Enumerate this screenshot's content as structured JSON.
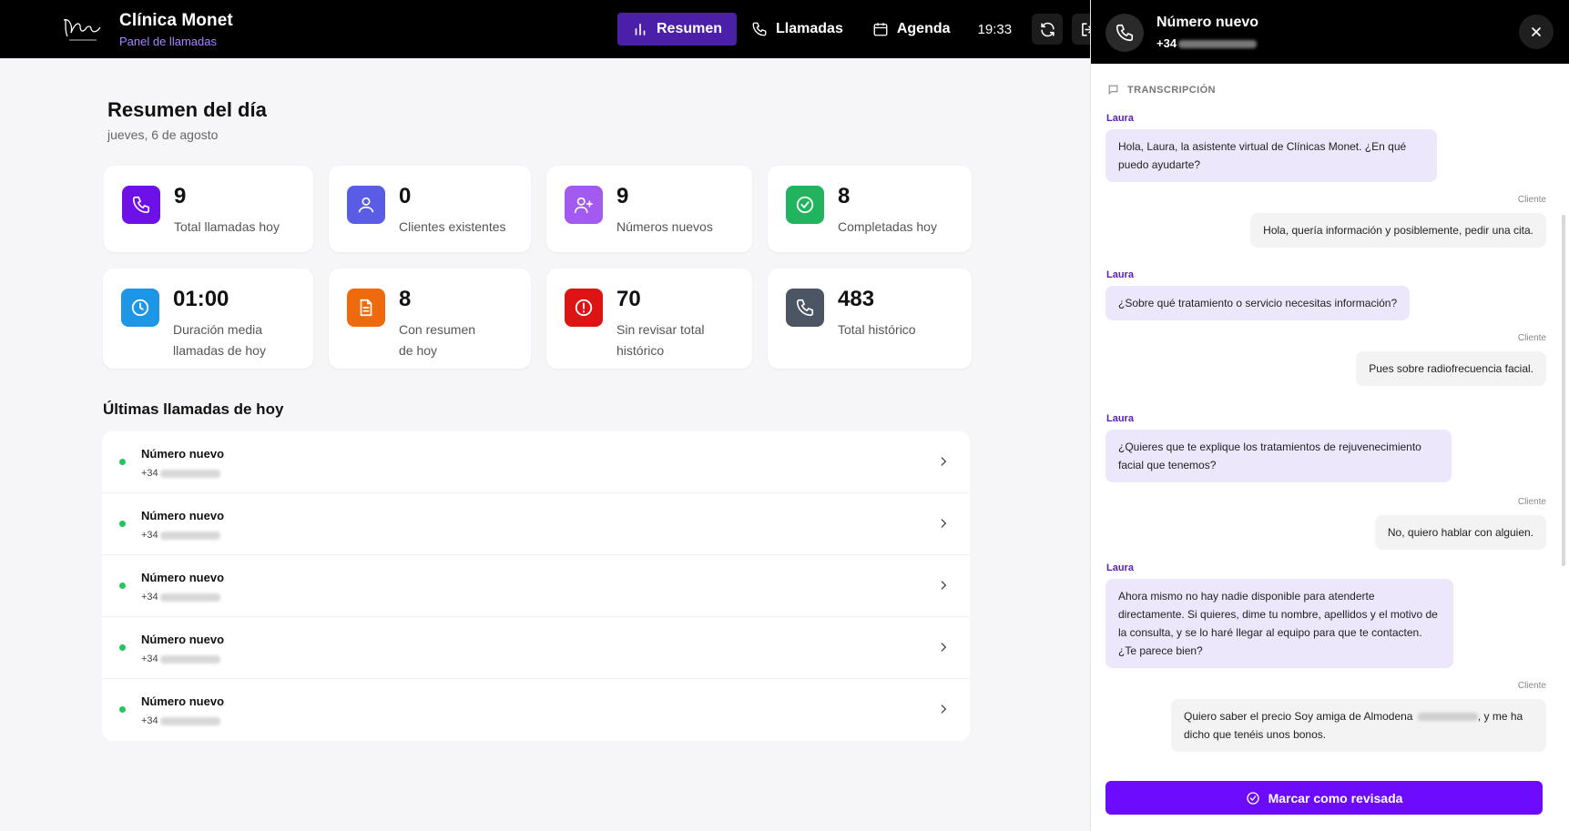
{
  "header": {
    "brand_title": "Clínica Monet",
    "brand_subtitle": "Panel de llamadas",
    "nav": [
      {
        "label": "Resumen",
        "active": true
      },
      {
        "label": "Llamadas",
        "active": false
      },
      {
        "label": "Agenda",
        "active": false
      }
    ],
    "time": "19:33"
  },
  "summary": {
    "title": "Resumen del día",
    "date": "jueves, 6 de agosto"
  },
  "stats": [
    {
      "value": "9",
      "label": "Total llamadas hoy",
      "color": "#6d11e8",
      "icon": "phone-icon"
    },
    {
      "value": "0",
      "label": "Clientes existentes",
      "color": "#5b5ce6",
      "icon": "user-icon"
    },
    {
      "value": "9",
      "label": "Números nuevos",
      "color": "#a35af0",
      "icon": "user-plus-icon"
    },
    {
      "value": "8",
      "label": "Completadas hoy",
      "color": "#22b35e",
      "icon": "check-circle-icon"
    },
    {
      "value": "01:00",
      "label": "Duración media llamadas de hoy",
      "color": "#1e96e6",
      "icon": "clock-icon"
    },
    {
      "value": "8",
      "label": "Con resumen de hoy",
      "color": "#ef6a0c",
      "icon": "document-icon"
    },
    {
      "value": "70",
      "label": "Sin revisar total histórico",
      "color": "#dc1414",
      "icon": "alert-circle-icon"
    },
    {
      "value": "483",
      "label": "Total histórico",
      "color": "#4b5563",
      "icon": "phone-icon"
    }
  ],
  "recent": {
    "title": "Últimas llamadas de hoy",
    "items": [
      {
        "name": "Número nuevo",
        "phone_prefix": "+34"
      },
      {
        "name": "Número nuevo",
        "phone_prefix": "+34"
      },
      {
        "name": "Número nuevo",
        "phone_prefix": "+34"
      },
      {
        "name": "Número nuevo",
        "phone_prefix": "+34"
      },
      {
        "name": "Número nuevo",
        "phone_prefix": "+34"
      }
    ]
  },
  "panel": {
    "title": "Número nuevo",
    "phone_prefix": "+34",
    "transcript_label": "TRANSCRIPCIÓN",
    "agent_name": "Laura",
    "client_tag": "Cliente",
    "messages": [
      {
        "from": "agent",
        "text": "Hola, Laura, la asistente virtual de Clínicas Monet. ¿En qué puedo ayudarte?"
      },
      {
        "from": "client",
        "text": "Hola, quería información y posiblemente, pedir una cita."
      },
      {
        "from": "agent",
        "text": "¿Sobre qué tratamiento o servicio necesitas información?"
      },
      {
        "from": "client",
        "text": "Pues sobre radiofrecuencia facial."
      },
      {
        "from": "agent",
        "text": "¿Quieres que te explique los tratamientos de rejuvenecimiento facial que tenemos?"
      },
      {
        "from": "client",
        "text": "No, quiero hablar con alguien."
      },
      {
        "from": "agent",
        "text": "Ahora mismo no hay nadie disponible para atenderte directamente. Si quieres, dime tu nombre, apellidos y el motivo de la consulta, y se lo haré llegar al equipo para que te contacten. ¿Te parece bien?"
      },
      {
        "from": "client",
        "text_before": "Quiero saber el precio Soy amiga de Almodena",
        "text_after": ", y me ha dicho que tenéis unos bonos."
      }
    ],
    "cta_label": "Marcar como revisada"
  }
}
